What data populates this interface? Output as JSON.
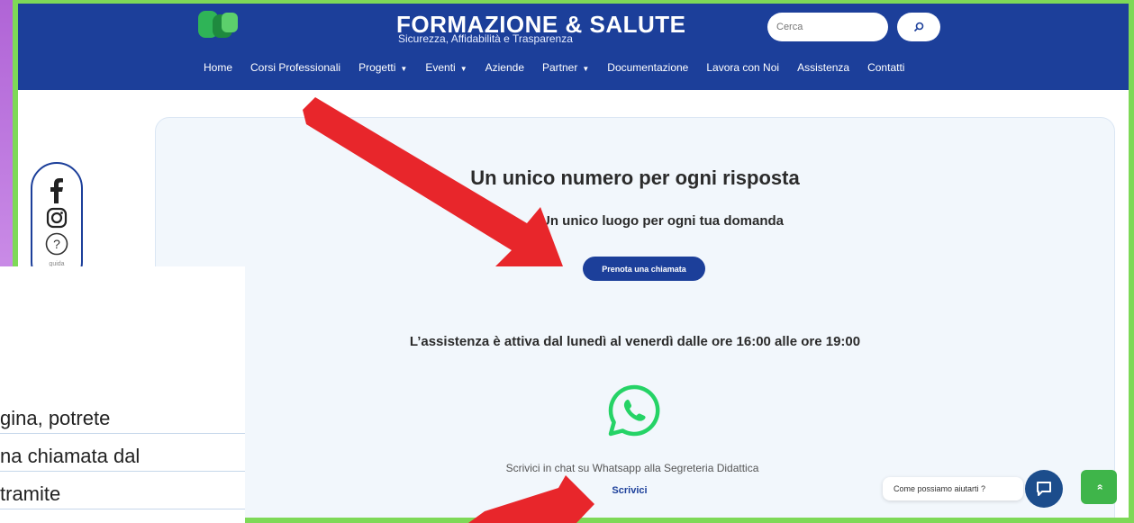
{
  "header": {
    "site_title": "FORMAZIONE & SALUTE",
    "site_tagline": "Sicurezza, Affidabilità e Trasparenza",
    "search_placeholder": "Cerca"
  },
  "nav": {
    "items": [
      {
        "label": "Home",
        "dropdown": false
      },
      {
        "label": "Corsi Professionali",
        "dropdown": false
      },
      {
        "label": "Progetti",
        "dropdown": true
      },
      {
        "label": "Eventi",
        "dropdown": true
      },
      {
        "label": "Aziende",
        "dropdown": false
      },
      {
        "label": "Partner",
        "dropdown": true
      },
      {
        "label": "Documentazione",
        "dropdown": false
      },
      {
        "label": "Lavora con Noi",
        "dropdown": false
      },
      {
        "label": "Assistenza",
        "dropdown": false
      },
      {
        "label": "Contatti",
        "dropdown": false
      }
    ]
  },
  "social": {
    "icons": [
      "facebook-icon",
      "instagram-icon",
      "help-icon"
    ],
    "help_label": "guida"
  },
  "main": {
    "heading": "Un unico numero per ogni risposta",
    "subheading": "Un unico luogo per ogni tua domanda",
    "book_call_label": "Prenota una chiamata",
    "hours_text": "L’assistenza è attiva dal lunedì al venerdì dalle ore 16:00 alle ore 19:00",
    "whatsapp_text": "Scrivici in chat su Whatsapp alla Segreteria Didattica",
    "write_link": "Scrivici"
  },
  "widgets": {
    "chat_prompt": "Come possiamo aiutarti ?",
    "scroll_top": "»"
  },
  "overlay": {
    "lines": [
      "gina, potrete",
      "na chiamata dal",
      " tramite"
    ]
  },
  "colors": {
    "header_blue": "#1c3f9a",
    "frame_green": "#7ed957",
    "arrow_red": "#e8262b",
    "whatsapp_green": "#25d366"
  }
}
